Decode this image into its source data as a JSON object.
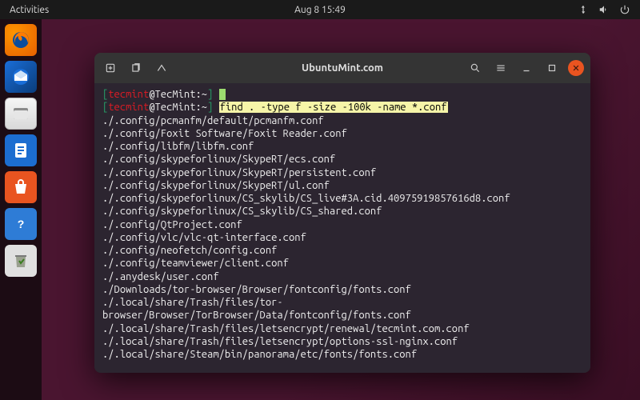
{
  "top": {
    "activities": "Activities",
    "datetime": "Aug 8  15:49"
  },
  "dock": {
    "items": [
      {
        "name": "firefox"
      },
      {
        "name": "thunderbird"
      },
      {
        "name": "files"
      },
      {
        "name": "document"
      },
      {
        "name": "software"
      },
      {
        "name": "help"
      },
      {
        "name": "trash"
      }
    ]
  },
  "window": {
    "title": "UbuntuMint.com"
  },
  "terminal": {
    "prompt": {
      "user": "tecmint",
      "host": "TecMint",
      "cwd": "~",
      "open_br": "[",
      "close_br": "]"
    },
    "command": "find . -type f -size -100k -name *.conf",
    "output": [
      "./.config/pcmanfm/default/pcmanfm.conf",
      "./.config/Foxit Software/Foxit Reader.conf",
      "./.config/libfm/libfm.conf",
      "./.config/skypeforlinux/SkypeRT/ecs.conf",
      "./.config/skypeforlinux/SkypeRT/persistent.conf",
      "./.config/skypeforlinux/SkypeRT/ul.conf",
      "./.config/skypeforlinux/CS_skylib/CS_live#3A.cid.40975919857616d8.conf",
      "./.config/skypeforlinux/CS_skylib/CS_shared.conf",
      "./.config/QtProject.conf",
      "./.config/vlc/vlc-qt-interface.conf",
      "./.config/neofetch/config.conf",
      "./.config/teamviewer/client.conf",
      "./.anydesk/user.conf",
      "./Downloads/tor-browser/Browser/fontconfig/fonts.conf",
      "./.local/share/Trash/files/tor-browser/Browser/TorBrowser/Data/fontconfig/fonts.conf",
      "./.local/share/Trash/files/letsencrypt/renewal/tecmint.com.conf",
      "./.local/share/Trash/files/letsencrypt/options-ssl-nginx.conf",
      "./.local/share/Steam/bin/panorama/etc/fonts/fonts.conf"
    ]
  }
}
